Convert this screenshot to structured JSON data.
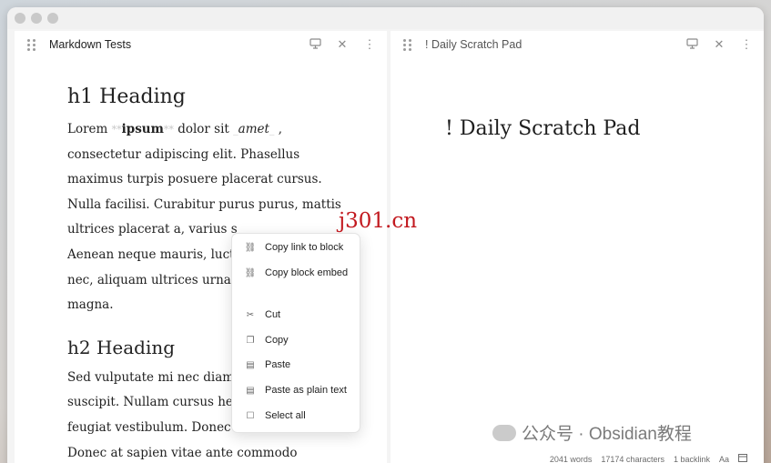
{
  "window": {
    "controls": [
      "close",
      "minimize",
      "zoom"
    ]
  },
  "left_pane": {
    "title": "Markdown Tests",
    "heading1": "h1 Heading",
    "para1": {
      "start": "Lorem ",
      "bold_marker_open": "**",
      "bold": "ipsum",
      "bold_marker_close": "**",
      "middle": " dolor sit ",
      "italic_marker_open": "_",
      "italic": "amet",
      "italic_marker_close": "_",
      "after_italic": " ,",
      "lines": [
        "consectetur adipiscing elit. Phasellus",
        "maximus turpis posuere placerat cursus.",
        "Nulla facilisi. Curabitur purus purus, mattis",
        "ultrices placerat a, varius s",
        "Aenean neque mauris, luctu",
        "nec, aliquam ultrices urna. ",
        "magna."
      ]
    },
    "heading2": "h2 Heading",
    "para2_lines": [
      "Sed vulputate mi nec diam",
      "suscipit. Nullam cursus hen",
      "feugiat vestibulum. Donec at lobortis eros.",
      "Donec at sapien vitae ante commodo"
    ]
  },
  "right_pane": {
    "title": "! Daily Scratch Pad",
    "heading": "! Daily Scratch Pad"
  },
  "header_icons": {
    "reading_view": "monitor-icon",
    "close": "close-icon",
    "more": "more-vertical-icon"
  },
  "context_menu": {
    "items": [
      {
        "label": "Copy link to block",
        "icon": "link-icon"
      },
      {
        "label": "Copy block embed",
        "icon": "link-icon"
      },
      {
        "label": "Cut",
        "icon": "scissors-icon"
      },
      {
        "label": "Copy",
        "icon": "copy-icon"
      },
      {
        "label": "Paste",
        "icon": "clipboard-icon"
      },
      {
        "label": "Paste as plain text",
        "icon": "clipboard-icon"
      },
      {
        "label": "Select all",
        "icon": "select-all-icon"
      }
    ]
  },
  "status_bar": {
    "words": "2041 words",
    "characters": "17174 characters",
    "backlinks": "1 backlink",
    "font_icon": "Aa"
  },
  "watermarks": {
    "red": "j301.cn",
    "gray": "公众号 · Obsidian教程"
  },
  "colors": {
    "accent_red": "#c2191f",
    "pane_bg": "#ffffff",
    "window_bg": "#f4f4f4"
  }
}
